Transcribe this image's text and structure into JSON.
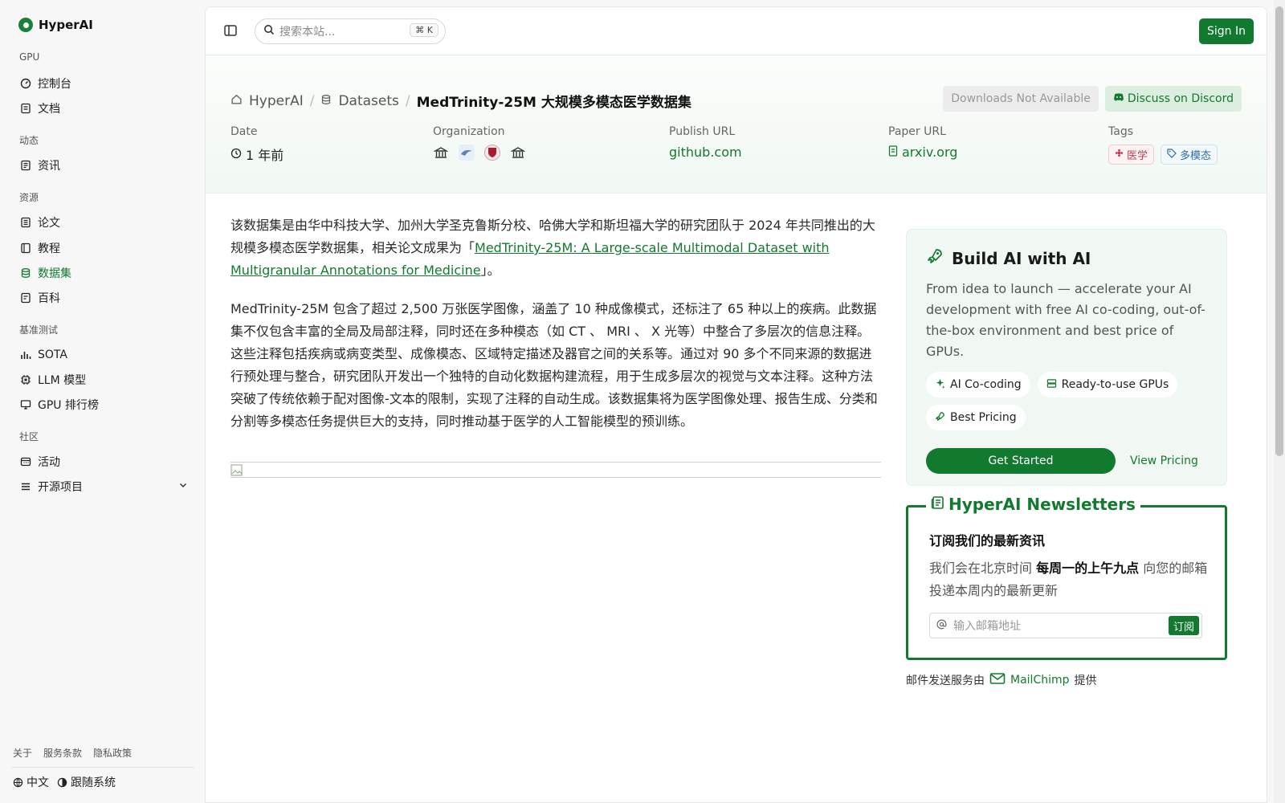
{
  "app": {
    "name": "HyperAI"
  },
  "sidebar": {
    "sections": [
      {
        "title": "GPU",
        "items": [
          {
            "label": "控制台",
            "icon": "dashboard-icon"
          },
          {
            "label": "文档",
            "icon": "doc-icon"
          }
        ]
      },
      {
        "title": "动态",
        "items": [
          {
            "label": "资讯",
            "icon": "news-icon"
          }
        ]
      },
      {
        "title": "资源",
        "items": [
          {
            "label": "论文",
            "icon": "paper-icon"
          },
          {
            "label": "教程",
            "icon": "tutorial-icon"
          },
          {
            "label": "数据集",
            "icon": "database-icon",
            "active": true
          },
          {
            "label": "百科",
            "icon": "wiki-icon"
          }
        ]
      },
      {
        "title": "基准测试",
        "items": [
          {
            "label": "SOTA",
            "icon": "chart-icon"
          },
          {
            "label": "LLM 模型",
            "icon": "chip-icon"
          },
          {
            "label": "GPU 排行榜",
            "icon": "monitor-icon"
          }
        ]
      },
      {
        "title": "社区",
        "items": [
          {
            "label": "活动",
            "icon": "event-icon"
          },
          {
            "label": "开源项目",
            "icon": "list-icon"
          }
        ]
      }
    ],
    "footer_links": [
      "关于",
      "服务条款",
      "隐私政策"
    ],
    "language": "中文",
    "theme": "跟随系统"
  },
  "topbar": {
    "search_placeholder": "搜索本站...",
    "search_shortcut": "K",
    "sign_in": "Sign In"
  },
  "header": {
    "breadcrumb": {
      "home": "HyperAI",
      "section": "Datasets",
      "current": "MedTrinity-25M 大规模多模态医学数据集"
    },
    "downloads": "Downloads Not Available",
    "discord": "Discuss on Discord",
    "meta": {
      "date_label": "Date",
      "date_value": "1 年前",
      "org_label": "Organization",
      "publish_label": "Publish URL",
      "publish_value": "github.com",
      "paper_label": "Paper URL",
      "paper_value": "arxiv.org",
      "tags_label": "Tags",
      "tags": [
        "医学",
        "多模态"
      ]
    }
  },
  "article": {
    "p1_before": "该数据集是由华中科技大学、加州大学圣克鲁斯分校、哈佛大学和斯坦福大学的研究团队于 2024 年共同推出的大规模多模态医学数据集，相关论文成果为「",
    "p1_link": "MedTrinity-25M: A Large-scale Multimodal Dataset with Multigranular Annotations for Medicine",
    "p1_after": "」。",
    "p2": "MedTrinity-25M 包含了超过 2,500 万张医学图像，涵盖了 10 种成像模式，还标注了 65 种以上的疾病。此数据集不仅包含丰富的全局及局部注释，同时还在多种模态（如 CT 、 MRI 、 X 光等）中整合了多层次的信息注释。这些注释包括疾病或病变类型、成像模态、区域特定描述及器官之间的关系等。通过对 90 多个不同来源的数据进行预处理与整合，研究团队开发出一个独特的自动化数据构建流程，用于生成多层次的视觉与文本注释。这种方法突破了传统依赖于配对图像-文本的限制，实现了注释的自动生成。该数据集将为医学图像处理、报告生成、分类和分割等多模态任务提供巨大的支持，同时推动基于医学的人工智能模型的预训练。"
  },
  "promo": {
    "title": "Build AI with AI",
    "desc": "From idea to launch — accelerate your AI development with free AI co-coding, out-of-the-box environment and best price of GPUs.",
    "chips": [
      "AI Co-coding",
      "Ready-to-use GPUs",
      "Best Pricing"
    ],
    "cta": "Get Started",
    "link": "View Pricing"
  },
  "newsletter": {
    "title": "HyperAI Newsletters",
    "subtitle": "订阅我们的最新资讯",
    "desc_before": "我们会在北京时间 ",
    "desc_bold": "每周一的上午九点",
    "desc_after": " 向您的邮箱投递本周内的最新更新",
    "placeholder": "输入邮箱地址",
    "button": "订阅"
  },
  "mail_credit": {
    "before": "邮件发送服务由",
    "service": "MailChimp",
    "after": "提供"
  },
  "colors": {
    "accent": "#127a2e",
    "background": "#f7f7f7"
  }
}
